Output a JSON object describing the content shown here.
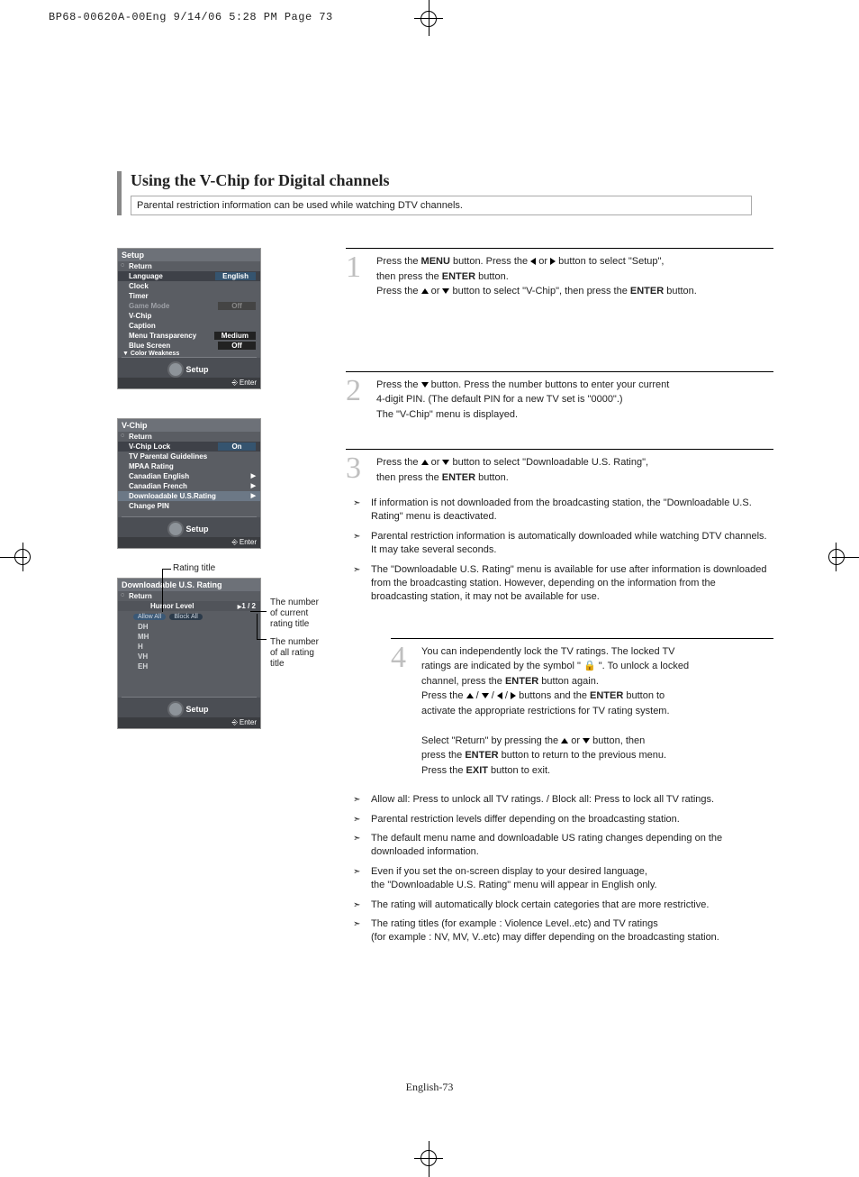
{
  "print_header": "BP68-00620A-00Eng  9/14/06  5:28 PM  Page 73",
  "title": "Using the V-Chip for Digital channels",
  "subtitle": "Parental restriction information can be used while watching DTV channels.",
  "menu1": {
    "head": "Setup",
    "return": "Return",
    "rows": [
      {
        "label": "Language",
        "value": "English",
        "sel": true
      },
      {
        "label": "Clock"
      },
      {
        "label": "Timer"
      },
      {
        "label": "Game Mode",
        "value": "Off",
        "dim": true
      },
      {
        "label": "V-Chip"
      },
      {
        "label": "Caption"
      },
      {
        "label": "Menu Transparency",
        "value": "Medium"
      },
      {
        "label": "Blue Screen",
        "value": "Off"
      }
    ],
    "more": "Color Weakness",
    "foot": "Setup",
    "enter": "Enter"
  },
  "menu2": {
    "head": "V-Chip",
    "return": "Return",
    "rows": [
      {
        "label": "V-Chip Lock",
        "value": "On",
        "sel": true
      },
      {
        "label": "TV Parental Guidelines"
      },
      {
        "label": "MPAA Rating"
      },
      {
        "label": "Canadian English",
        "arrow": true
      },
      {
        "label": "Canadian French",
        "arrow": true
      },
      {
        "label": "Downloadable U.S.Rating",
        "arrow": true,
        "hl": true
      },
      {
        "label": "Change PIN"
      }
    ],
    "foot": "Setup",
    "enter": "Enter"
  },
  "menu3": {
    "head": "Downloadable U.S. Rating",
    "return": "Return",
    "col": "Humor Level",
    "page": "1 / 2",
    "allow": "Allow All",
    "block": "Block All",
    "ratings": [
      "DH",
      "MH",
      "H",
      "VH",
      "EH"
    ],
    "foot": "Setup",
    "enter": "Enter"
  },
  "anno": {
    "rating_title": "Rating title",
    "num_current": "The number\nof current\nrating title",
    "num_all": "The number\nof all rating\ntitle"
  },
  "step1": {
    "n": "1",
    "t1a": "Press the ",
    "menu": "MENU",
    "t1b": " button. Press the ",
    "t1c": " or ",
    "t1d": " button to select \"Setup\",",
    "t2a": "then press the ",
    "enter": "ENTER",
    "t2b": " button.",
    "t3a": "Press the ",
    "t3b": " or ",
    "t3c": " button to select \"V-Chip\", then press the ",
    "t3d": " button."
  },
  "step2": {
    "n": "2",
    "t1a": "Press the ",
    "t1b": " button. Press the number buttons to enter your current",
    "t2": "4-digit PIN. (The default PIN for a new TV set is \"0000\".)",
    "t3": "The \"V-Chip\" menu is displayed."
  },
  "step3": {
    "n": "3",
    "t1a": "Press the ",
    "t1b": " or ",
    "t1c": " button to select \"Downloadable U.S. Rating\",",
    "t2a": "then press the ",
    "enter": "ENTER",
    "t2b": " button."
  },
  "notes3": [
    "If information is not downloaded from the broadcasting station, the \"Downloadable U.S. Rating\" menu is deactivated.",
    "Parental restriction information is automatically downloaded while watching DTV channels. It may take several seconds.",
    "The \"Downloadable U.S. Rating\" menu is available for use after information is downloaded from the broadcasting station. However, depending on the information from the broadcasting station, it may not be available for use."
  ],
  "step4": {
    "n": "4",
    "t1": "You can independently lock the TV ratings. The locked TV",
    "t2a": "ratings are indicated by the symbol \" ",
    "t2b": " \". To unlock a locked",
    "t3a": "channel, press the ",
    "enter": "ENTER",
    "t3b": " button again.",
    "t4a": "Press the ",
    "t4b": " buttons and the ",
    "t4c": " button to",
    "t5": "activate the appropriate restrictions for TV rating system.",
    "t6a": "Select \"Return\" by pressing the ",
    "t6b": " or ",
    "t6c": " button, then",
    "t7a": "press the ",
    "t7b": " button to return to the previous menu.",
    "t8a": "Press the ",
    "exit": "EXIT",
    "t8b": " button to exit."
  },
  "notes4": [
    "Allow all: Press to unlock all TV ratings. / Block all: Press to lock all TV ratings.",
    "Parental restriction levels differ depending on the broadcasting station.",
    "The default menu name and downloadable US rating changes depending on the downloaded information.",
    "Even if you set the on-screen display to your desired language,\nthe \"Downloadable U.S. Rating\" menu will appear in English only.",
    "The rating will automatically block certain categories that are more restrictive.",
    "The rating titles (for example : Violence Level..etc) and TV ratings\n(for example : NV, MV, V..etc) may differ depending on the broadcasting station."
  ],
  "page_num": "English-73"
}
